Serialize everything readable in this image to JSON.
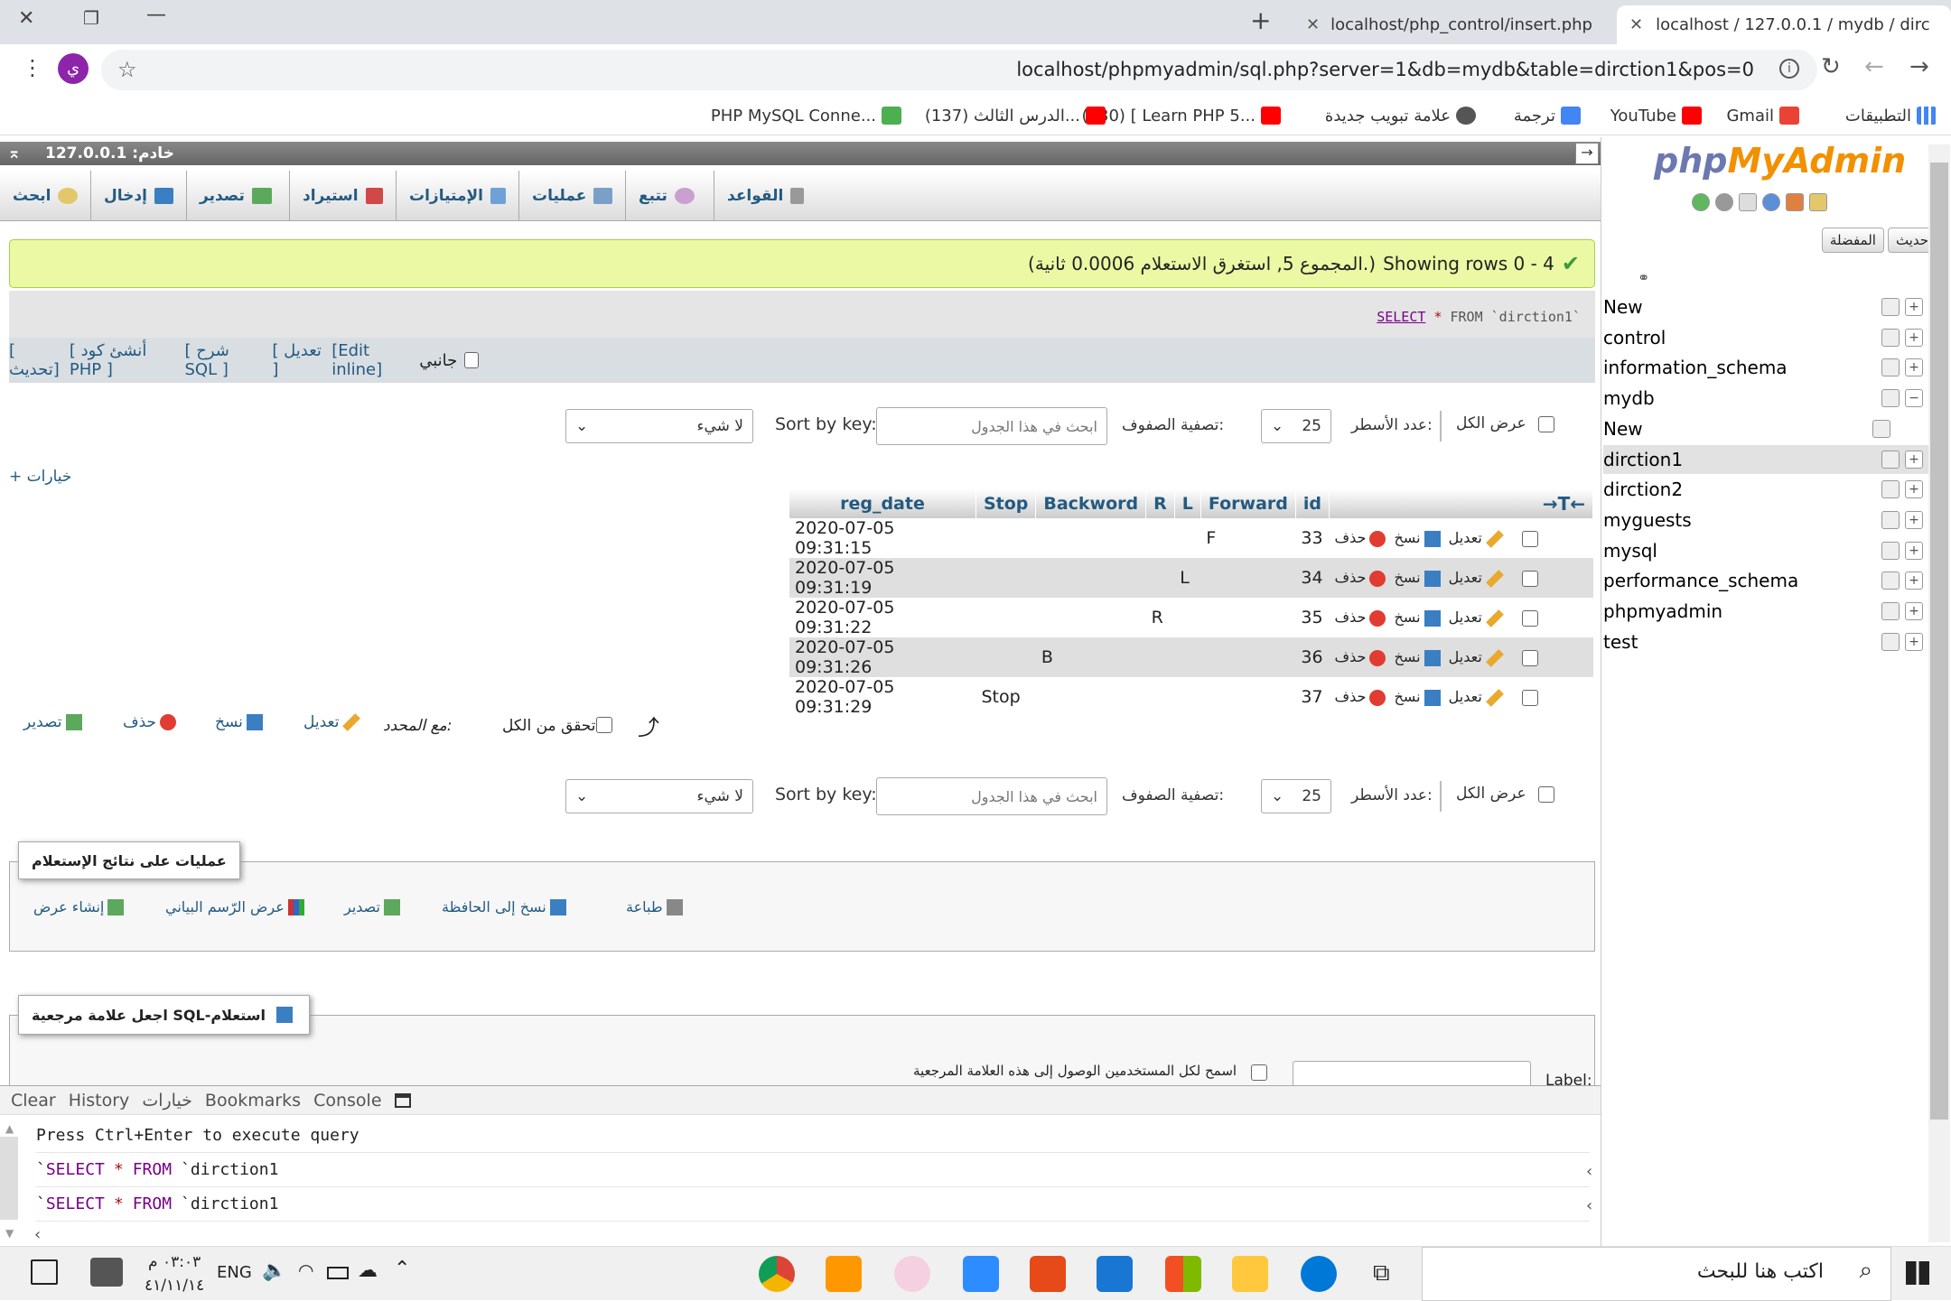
{
  "browser": {
    "tabs": [
      {
        "label": "localhost/php_control/insert.php"
      },
      {
        "label": "localhost / 127.0.0.1 / mydb / dirc"
      }
    ],
    "url": "localhost/phpmyadmin/sql.php?server=1&db=mydb&table=dirction1&pos=0",
    "profile": "ي",
    "bookmarks": [
      "التطبيقات",
      "Gmail",
      "YouTube",
      "ترجمة",
      "علامة تبويب جديدة",
      "(130) [ Learn PHP 5...",
      "(137) الدرس الثالث...",
      "PHP MySQL Conne..."
    ]
  },
  "server": {
    "label": "خادم: 127.0.0.1"
  },
  "menu": [
    "القواعد",
    "تتبع",
    "عمليات",
    "الإمتيازات",
    "استيراد",
    "تصدير",
    "إدخال",
    "ابحث"
  ],
  "result": {
    "message": "Showing rows 0 - 4",
    "detail": "(المجموع 5, استغرق الاستعلام 0.0006 ثانية.)",
    "sql_kw": "SELECT",
    "sql_star": "*",
    "sql_rest": "FROM `dirction1`",
    "links": {
      "profile": "جانبي",
      "edit_inline": "[Edit inline]",
      "edit": "[ تعديل ]",
      "explain": "[ شرح SQL ]",
      "php": "[ أنشئ كود PHP ]",
      "refresh": "[ تحديث]"
    }
  },
  "nav": {
    "show_all": "عرض الكل",
    "rows_label": "عدد الأسطر:",
    "rows_value": "25",
    "filter_label": "تصفية الصفوف:",
    "filter_placeholder": "ابحث في هذا الجدول",
    "sortkey_label": "Sort by key:",
    "sortkey_value": "لا شيء",
    "options": "+ خيارات"
  },
  "table": {
    "arrows": "←T→",
    "columns": [
      "id",
      "Forward",
      "L",
      "R",
      "Backword",
      "Stop",
      "reg_date"
    ],
    "edit": "تعديل",
    "copy": "نسخ",
    "delete": "حذف",
    "rows": [
      {
        "id": "33",
        "Forward": "F",
        "L": "",
        "R": "",
        "Backword": "",
        "Stop": "",
        "reg_date": "2020-07-05 09:31:15"
      },
      {
        "id": "34",
        "Forward": "",
        "L": "L",
        "R": "",
        "Backword": "",
        "Stop": "",
        "reg_date": "2020-07-05 09:31:19"
      },
      {
        "id": "35",
        "Forward": "",
        "L": "",
        "R": "R",
        "Backword": "",
        "Stop": "",
        "reg_date": "2020-07-05 09:31:22"
      },
      {
        "id": "36",
        "Forward": "",
        "L": "",
        "R": "",
        "Backword": "B",
        "Stop": "",
        "reg_date": "2020-07-05 09:31:26"
      },
      {
        "id": "37",
        "Forward": "",
        "L": "",
        "R": "",
        "Backword": "",
        "Stop": "Stop",
        "reg_date": "2020-07-05 09:31:29"
      }
    ]
  },
  "bulk": {
    "check_all": "تحقق من الكل",
    "with_selected": "مع المحدد:",
    "edit": "تعديل",
    "copy": "نسخ",
    "delete": "حذف",
    "export": "تصدير"
  },
  "ops": {
    "legend": "عمليات على نتائج الإستعلام",
    "print": "طباعة",
    "copy_clip": "نسخ إلى الحافظة",
    "export": "تصدير",
    "chart": "عرض الرّسم البياني",
    "view": "إنشاء عرض"
  },
  "bookmark": {
    "legend": "اجعل علامة مرجعية SQL-استعلام",
    "share": "اسمح لكل المستخدمين الوصول إلى هذه العلامة المرجعية",
    "label": "Label:"
  },
  "console": {
    "toolbar": [
      "Clear",
      "History",
      "خيارات",
      "Bookmarks",
      "Console"
    ],
    "hint": "Press Ctrl+Enter to execute query",
    "q1a": "`",
    "q1kw": "SELECT",
    "q1star": "*",
    "q1from": "FROM",
    "q1rest": "`dirction1"
  },
  "sidebar": {
    "logo_php": "php",
    "logo_my": "MyAdmin",
    "recent": "حديث",
    "favorites": "المفضلة",
    "tree": [
      {
        "label": "New",
        "sign": "+"
      },
      {
        "label": "control",
        "sign": "+"
      },
      {
        "label": "information_schema",
        "sign": "+"
      },
      {
        "label": "mydb",
        "sign": "−"
      },
      {
        "label": "New",
        "sign": ""
      },
      {
        "label": "dirction1",
        "sign": "+"
      },
      {
        "label": "dirction2",
        "sign": "+"
      },
      {
        "label": "myguests",
        "sign": "+"
      },
      {
        "label": "mysql",
        "sign": "+"
      },
      {
        "label": "performance_schema",
        "sign": "+"
      },
      {
        "label": "phpmyadmin",
        "sign": "+"
      },
      {
        "label": "test",
        "sign": "+"
      }
    ]
  },
  "taskbar": {
    "search": "اكتب هنا للبحث",
    "lang": "ENG",
    "time": "٠٣:٠٣ م",
    "date": "٤١/١١/١٤"
  }
}
